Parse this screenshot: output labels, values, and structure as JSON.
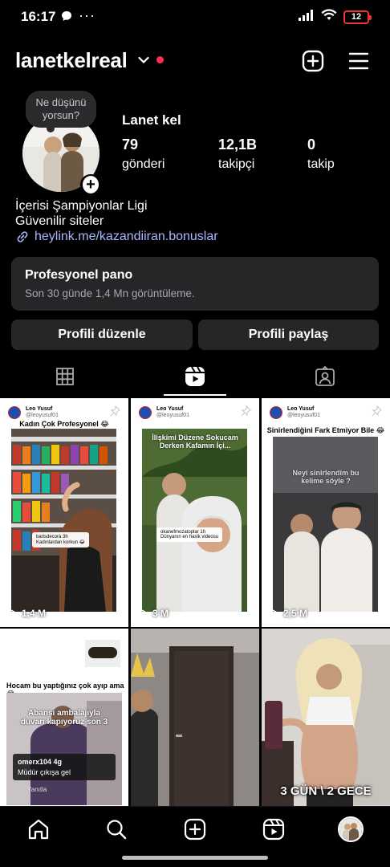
{
  "status_bar": {
    "time": "16:17",
    "dots": "···",
    "battery": "12"
  },
  "header": {
    "username": "lanetkelreal"
  },
  "profile": {
    "note": "Ne düşünü yorsun?",
    "display_name": "Lanet kel",
    "stats": [
      {
        "value": "79",
        "label": "gönderi"
      },
      {
        "value": "12,1B",
        "label": "takipçi"
      },
      {
        "value": "0",
        "label": "takip"
      }
    ],
    "bio_lines": [
      "İçerisi Şampiyonlar Ligi",
      "Güvenilir siteler"
    ],
    "link": "heylink.me/kazandiiran.bonuslar"
  },
  "dashboard": {
    "title": "Profesyonel pano",
    "subtitle": "Son 30 günde 1,4 Mn görüntüleme."
  },
  "buttons": {
    "edit": "Profili düzenle",
    "share": "Profili paylaş"
  },
  "grid": {
    "posts": [
      {
        "author": "Leo Yusuf",
        "handle": "@leoyusuf01",
        "caption": "Kadın Çok Profesyonel 😂",
        "comment_user": "barisdecorà 3h",
        "comment_text": "Kadınlardan korkun 😂",
        "views": "1,4 M"
      },
      {
        "author": "Leo Yusuf",
        "handle": "@leoyusuf01",
        "caption": "İlişkimi Düzene Sokucam Derken Kafamın İçi...",
        "comment_user": "okanefmozatoplar 1h",
        "comment_text": "Dünyanın en haslk videosu",
        "views": "3 M"
      },
      {
        "author": "Leo Yusuf",
        "handle": "@leoyusuf01",
        "caption": "Sinirlendiğini Fark Etmiyor Bile 😂",
        "overlay": "Neyi sinirlendim bu kelime söyle ?",
        "views": "2,5 M"
      },
      {
        "caption": "Hocam bu yaptığınız çok ayıp ama 😂",
        "overlay": "Abansı ambalajıyla duvarı kapıyoruz son 3",
        "comment_user": "omerx104 4g",
        "comment_text": "Müdür çıkışa gel",
        "reply": "Yanıtla"
      },
      {},
      {
        "overlay": "3 GÜN \\ 2 GECE"
      }
    ]
  }
}
